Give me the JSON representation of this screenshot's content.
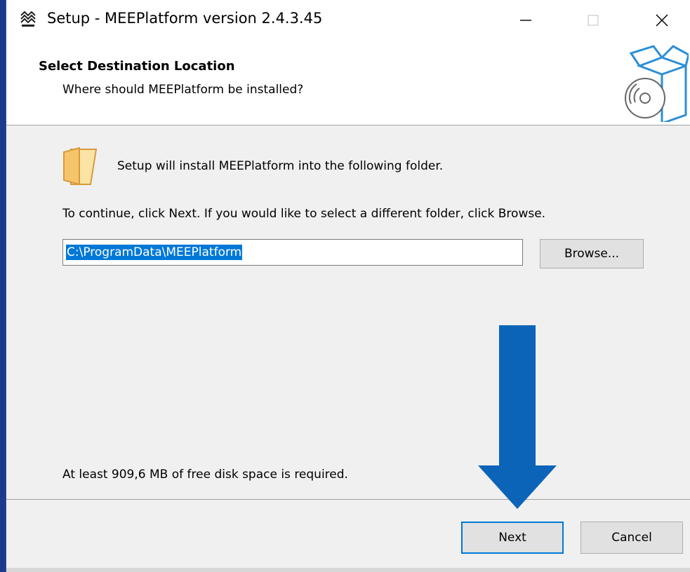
{
  "window": {
    "title": "Setup - MEEPlatform version 2.4.3.45",
    "app_icon": "mee-logo-icon",
    "controls": {
      "minimize": "minimize-icon",
      "maximize": "maximize-icon",
      "close": "close-icon"
    }
  },
  "header": {
    "title": "Select Destination Location",
    "subtitle": "Where should MEEPlatform be installed?",
    "icon": "install-box-disc-icon"
  },
  "content": {
    "folder_icon": "folder-icon",
    "install_text": "Setup will install MEEPlatform into the following folder.",
    "continue_text": "To continue, click Next. If you would like to select a different folder, click Browse.",
    "path_value": "C:\\ProgramData\\MEEPlatform",
    "browse_label": "Browse...",
    "space_text": "At least 909,6 MB of free disk space is required."
  },
  "footer": {
    "next_label": "Next",
    "cancel_label": "Cancel"
  },
  "annotation": {
    "icon": "down-arrow-icon",
    "color": "#0b64b8"
  },
  "colors": {
    "selection": "#0078d7",
    "default_button_border": "#0078d7",
    "folder": "#f6c56b"
  }
}
